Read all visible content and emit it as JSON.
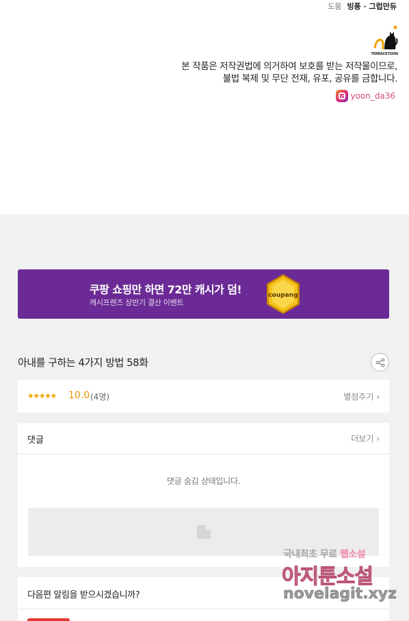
{
  "credits": {
    "label": "도움",
    "value": "빙퐁 · 그럽만듀"
  },
  "logo": {
    "text": "TERRACETOON"
  },
  "notice": {
    "line1": "본 작품은 저작권법에 의거하여 보호를 받는 저작물이므로,",
    "line2": "불법 복제 및 무단 전재, 유포, 공유를 금합니다."
  },
  "instagram": {
    "handle": "yoon_da36"
  },
  "banner": {
    "title": "쿠팡 쇼핑만 하면 72만 캐시가 덤!",
    "subtitle": "캐시프렌즈 상반기 결산 이벤트",
    "coin_text": "coupang",
    "bg_color": "#6b2a95"
  },
  "episode": {
    "title": "아내를 구하는 4가지 방법 58화"
  },
  "rating": {
    "stars": "★★★★★",
    "score": "10.0",
    "count": "(4명)",
    "rate_label": "별점주기"
  },
  "comments": {
    "label": "댓글",
    "more_label": "더보기",
    "hidden_message": "댓글 숨김 상태입니다."
  },
  "notify": {
    "question": "다음편 알림을 받으시겠습니까?"
  },
  "watermark": {
    "line1": "국내최초 무료",
    "line1b": "웹소설",
    "line2": "아지툰소설",
    "line3": "novelagit.xyz"
  }
}
